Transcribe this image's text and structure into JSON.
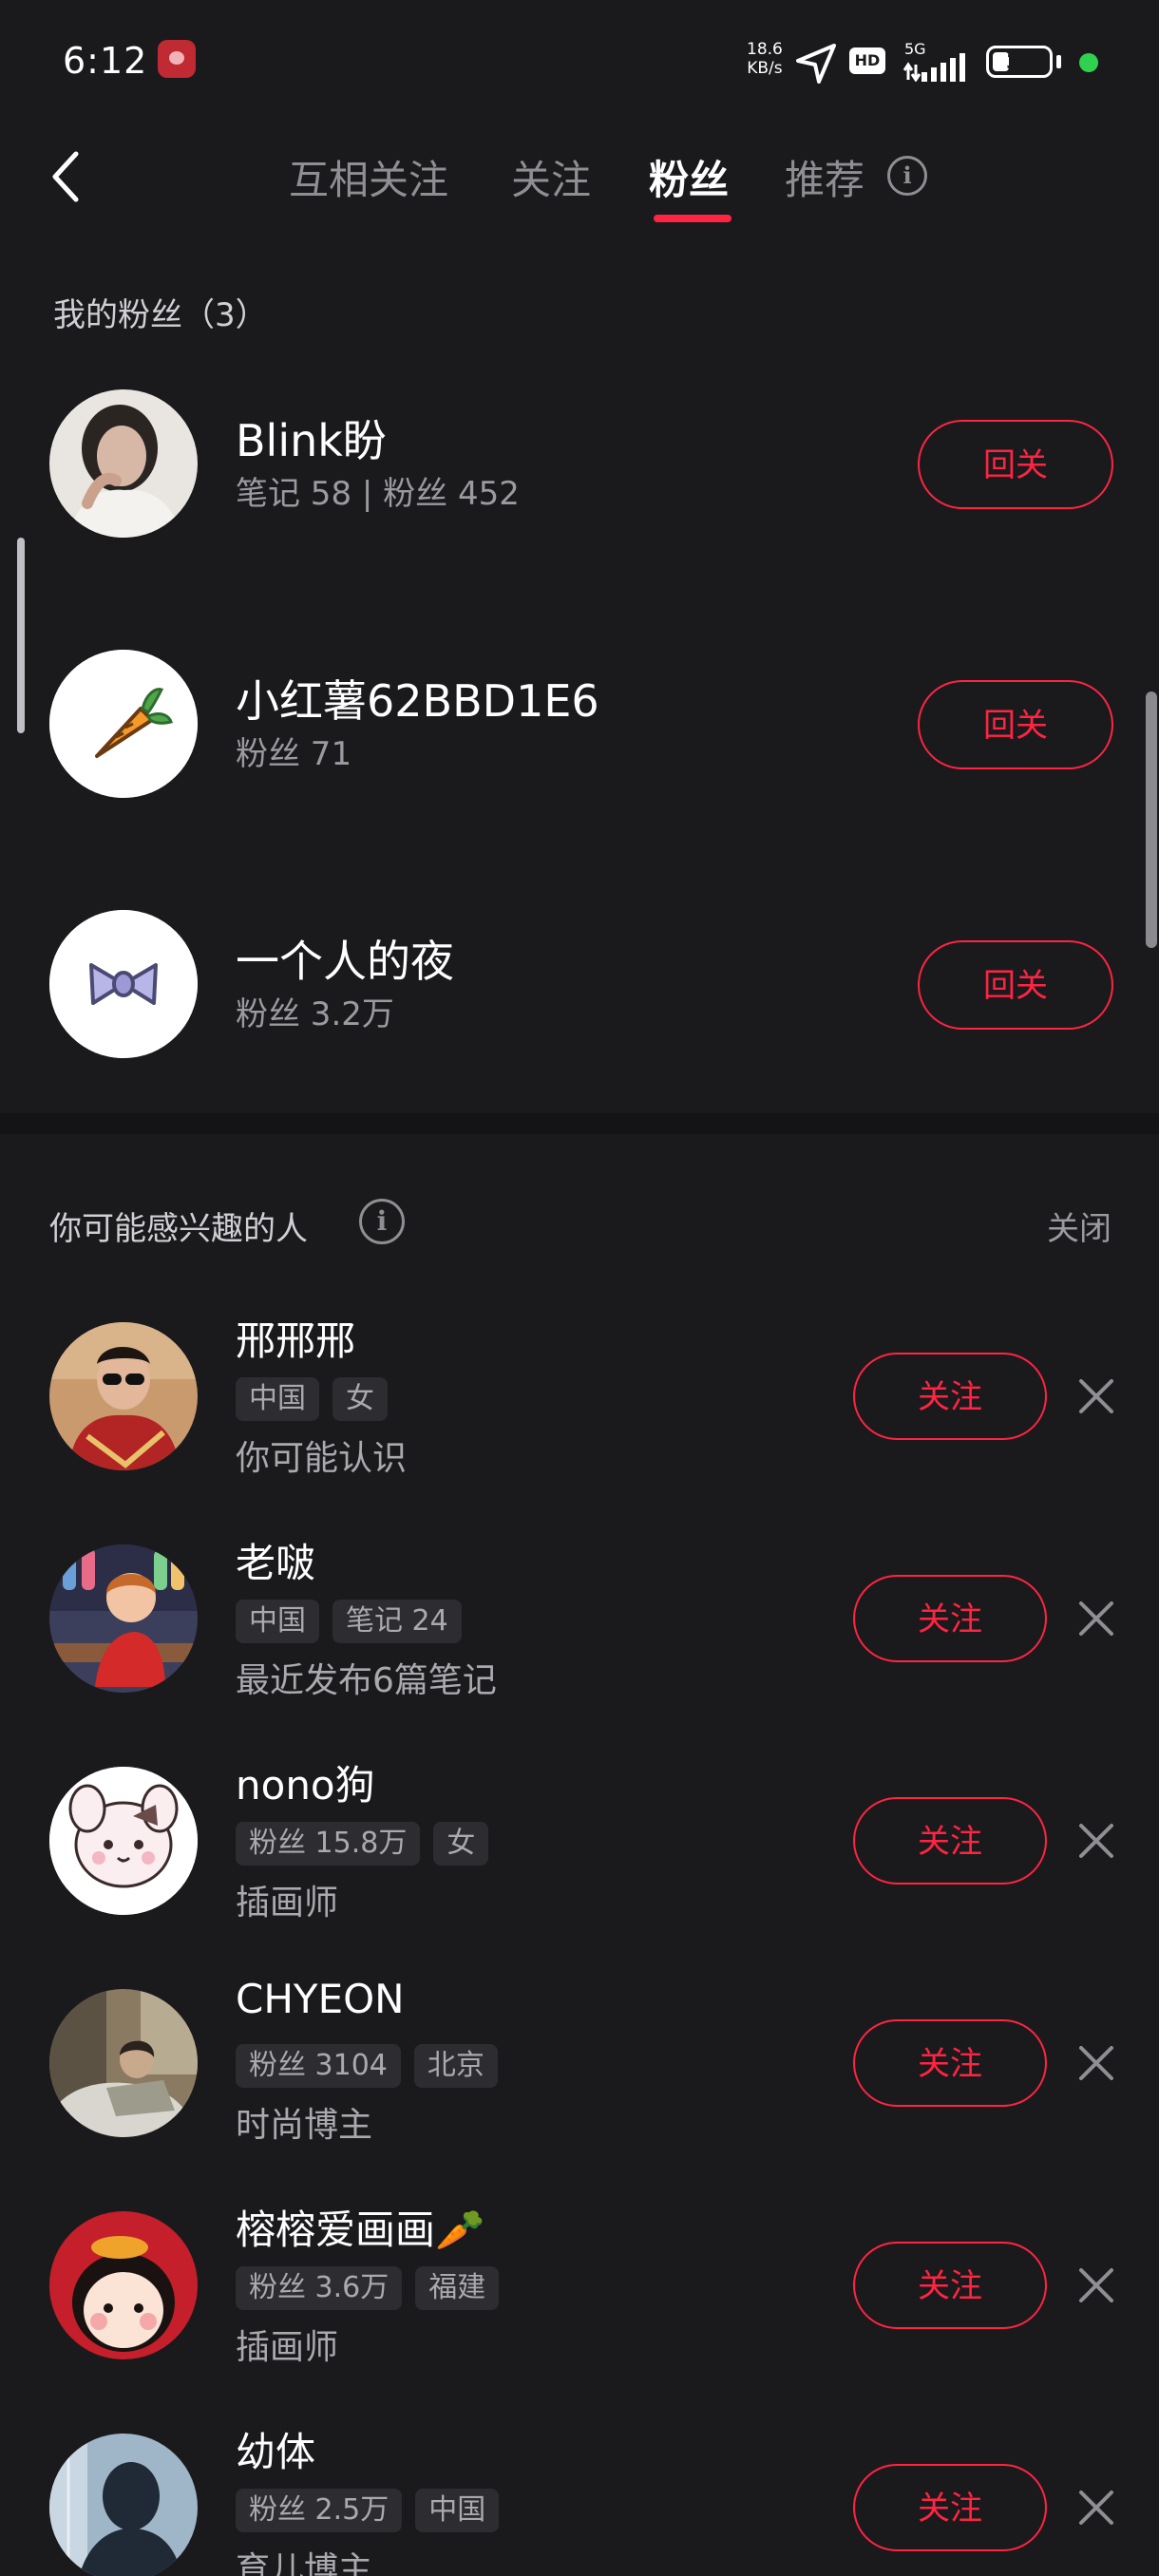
{
  "status_bar": {
    "time": "6:12",
    "net_speed_value": "18.6",
    "net_speed_unit": "KB/s",
    "hd": "HD",
    "signal": "5G",
    "battery": "31",
    "battery_level": 0.31
  },
  "nav": {
    "tabs": [
      {
        "label": "互相关注"
      },
      {
        "label": "关注"
      },
      {
        "label": "粉丝"
      },
      {
        "label": "推荐"
      }
    ],
    "active_tab": "粉丝",
    "info_icon": "i"
  },
  "fans": {
    "title": "我的粉丝（3）",
    "items": [
      {
        "name": "Blink盼",
        "meta": "笔记 58 | 粉丝 452",
        "button": "回关"
      },
      {
        "name": "小红薯62BBD1E6",
        "meta": "粉丝 71",
        "button": "回关"
      },
      {
        "name": "一个人的夜",
        "meta": "粉丝 3.2万",
        "button": "回关"
      }
    ]
  },
  "suggestions": {
    "title": "你可能感兴趣的人",
    "info_icon": "i",
    "close_label": "关闭",
    "items": [
      {
        "name": "邢邢邢",
        "tags": [
          "中国",
          "女"
        ],
        "desc": "你可能认识",
        "button": "关注"
      },
      {
        "name": "老啵",
        "tags": [
          "中国",
          "笔记 24"
        ],
        "desc": "最近发布6篇笔记",
        "button": "关注"
      },
      {
        "name": "nono狗",
        "tags": [
          "粉丝 15.8万",
          "女"
        ],
        "desc": "插画师",
        "button": "关注"
      },
      {
        "name": "CHYEON",
        "tags": [
          "粉丝 3104",
          "北京"
        ],
        "desc": "时尚博主",
        "button": "关注"
      },
      {
        "name": "榕榕爱画画🥕",
        "tags": [
          "粉丝 3.6万",
          "福建"
        ],
        "desc": "插画师",
        "button": "关注"
      },
      {
        "name": "幼体",
        "tags": [
          "粉丝 2.5万",
          "中国"
        ],
        "desc": "育儿博主",
        "button": "关注"
      }
    ]
  },
  "colors": {
    "background": "#1a1a1d",
    "accent": "#ff2442",
    "muted_text": "#9a9aa0"
  }
}
